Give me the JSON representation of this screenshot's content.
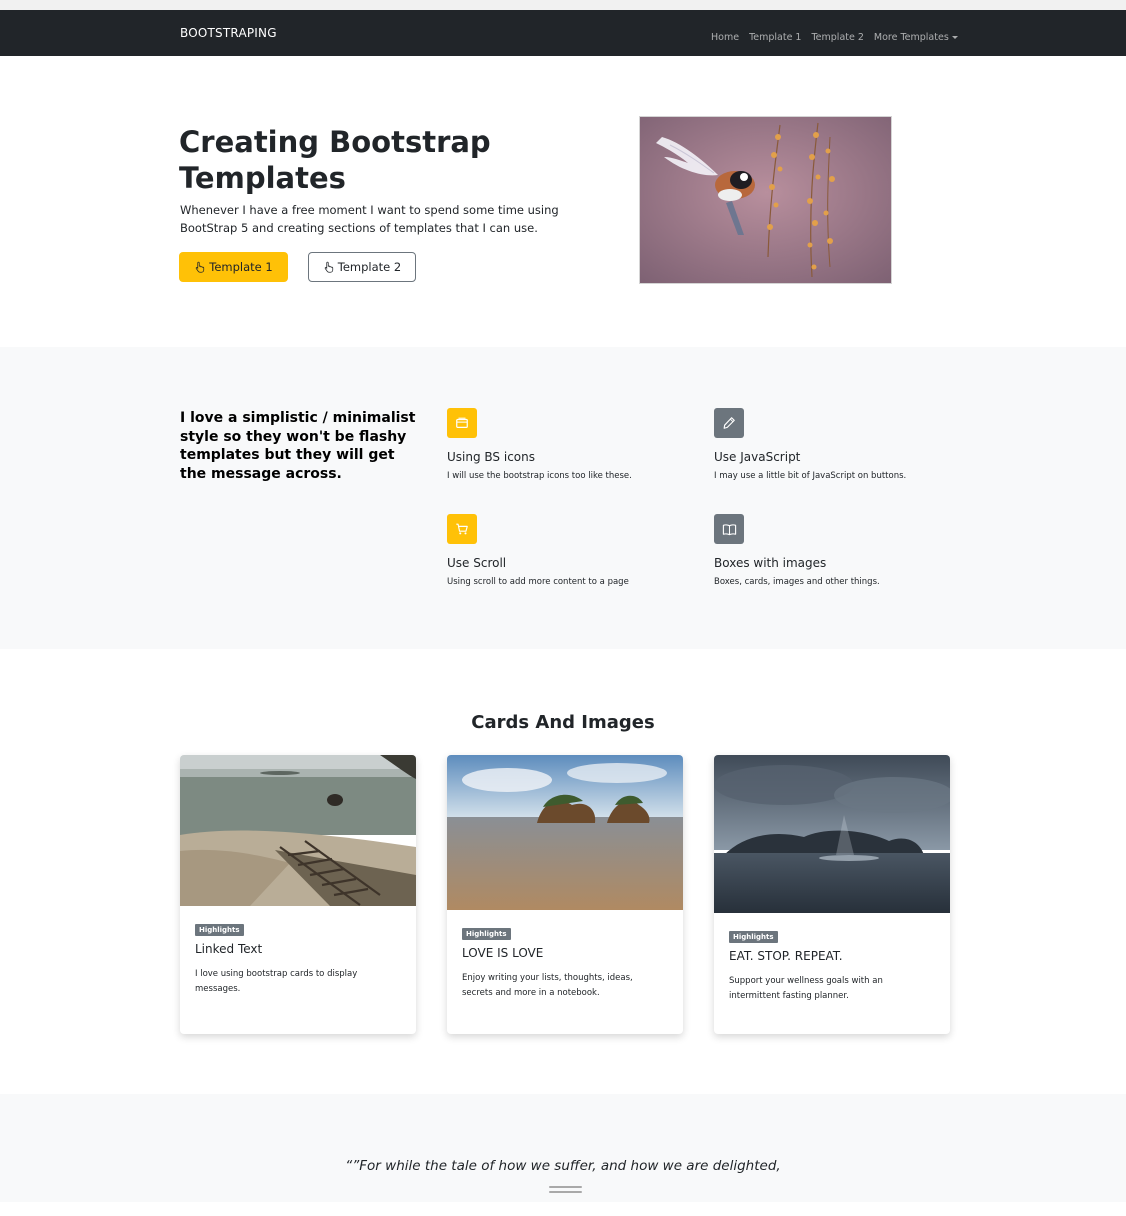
{
  "navbar": {
    "brand": "BOOTSTRAPING",
    "links": [
      "Home",
      "Template 1",
      "Template 2"
    ],
    "dropdown_label": "More Templates"
  },
  "hero": {
    "title": "Creating Bootstrap Templates",
    "text": "Whenever I have a free moment I want to spend some time using BootStrap 5 and creating sections of templates that I can use.",
    "primary_button": "Template 1",
    "secondary_button": "Template 2",
    "button_icon": "hand-pointer-icon",
    "image": "bird-flying-near-flowers-photo"
  },
  "features": {
    "lead": "I love a simplistic / minimalist style so they won't be flashy templates but they will get the message across.",
    "items": [
      {
        "icon": "window-icon",
        "title": "Using BS icons",
        "text": "I will use the bootstrap icons too like these."
      },
      {
        "icon": "pencil-icon",
        "title": "Use JavaScript",
        "text": "I may use a little bit of JavaScript on buttons."
      },
      {
        "icon": "cart-icon",
        "title": "Use Scroll",
        "text": "Using scroll to add more content to a page"
      },
      {
        "icon": "book-icon",
        "title": "Boxes with images",
        "text": "Boxes, cards, images and other things."
      }
    ]
  },
  "cards_section": {
    "title": "Cards And Images",
    "cards": [
      {
        "badge": "Highlights",
        "title": "Linked Text",
        "text": "I love using bootstrap cards to display messages.",
        "image": "beach-with-wooden-stairs-photo"
      },
      {
        "badge": "Highlights",
        "title": "LOVE IS LOVE",
        "text": "Enjoy writing your lists, thoughts, ideas, secrets and more in a notebook.",
        "image": "rock-islands-sea-photo"
      },
      {
        "badge": "Highlights",
        "title": "EAT. STOP. REPEAT.",
        "text": "Support your wellness goals with an intermittent fasting planner.",
        "image": "stormy-sea-mountains-photo"
      }
    ]
  },
  "quote": {
    "text": "“”For while the tale of how we suffer, and how we are delighted,"
  },
  "colors": {
    "navbar_bg": "#212529",
    "accent_yellow": "#ffc107",
    "secondary_gray": "#6c757d",
    "section_bg": "#f8f9fa"
  }
}
